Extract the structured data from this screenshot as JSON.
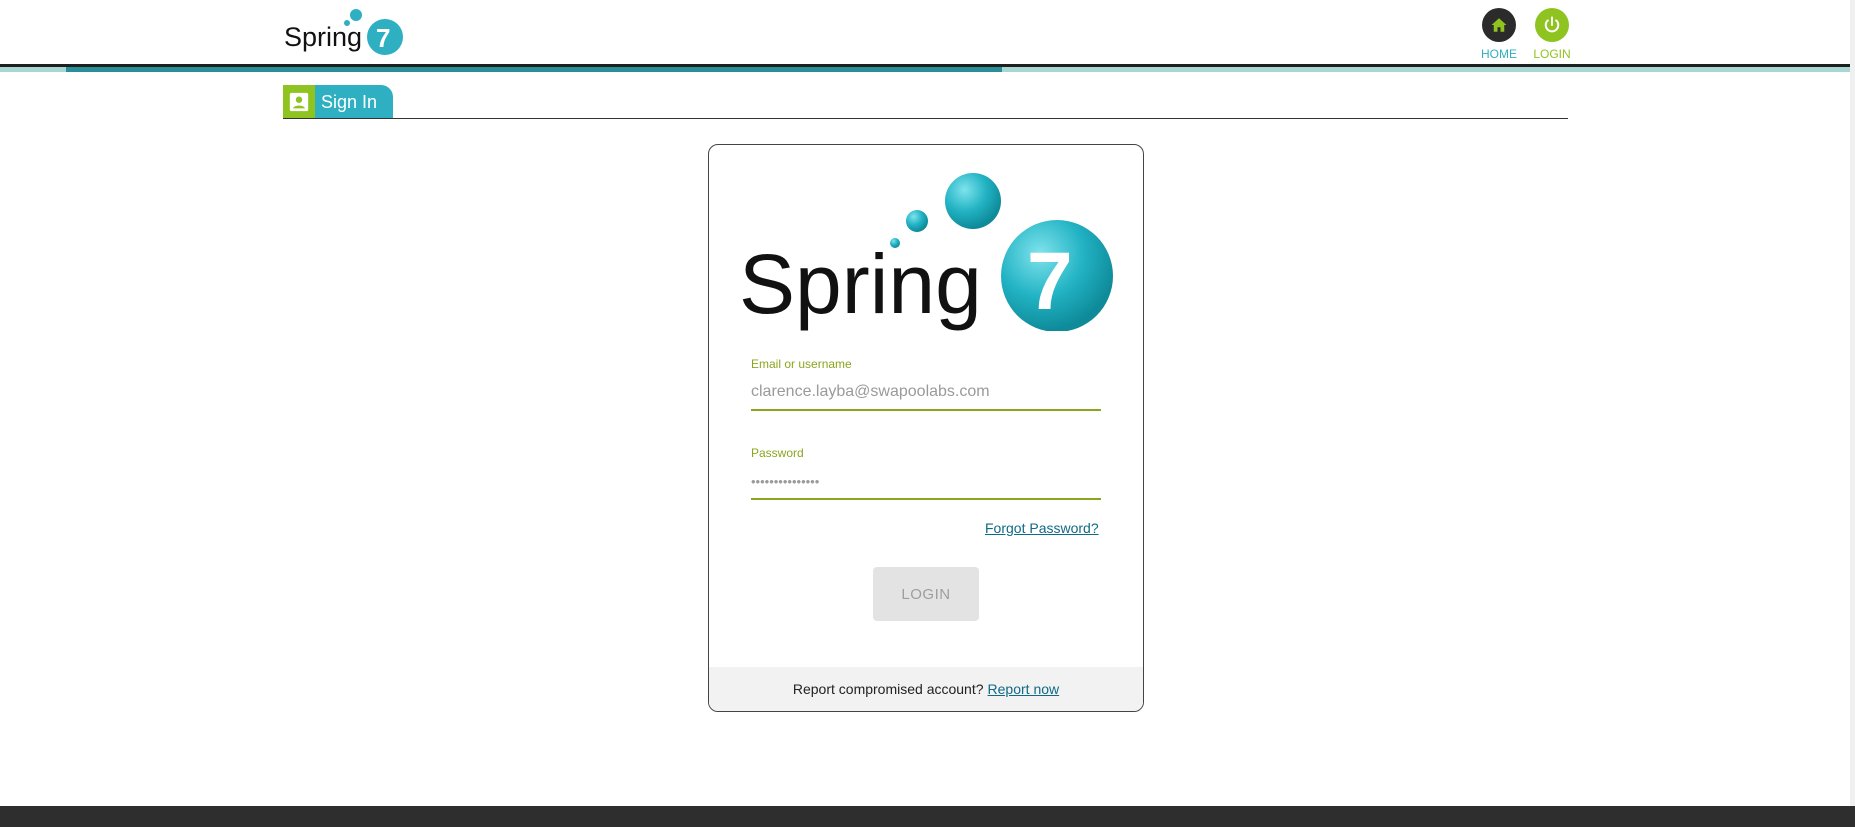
{
  "header": {
    "logo_text": "Spring7",
    "nav": {
      "home_label": "HOME",
      "login_label": "LOGIN"
    }
  },
  "tab": {
    "label": "Sign In"
  },
  "login_card": {
    "logo_text": "Spring7",
    "email": {
      "label": "Email or username",
      "value": "clarence.layba@swapoolabs.com"
    },
    "password": {
      "label": "Password",
      "value": "•••••••••••••••"
    },
    "forgot_label": "Forgot Password?",
    "login_label": "LOGIN",
    "footer": {
      "text": "Report compromised account?",
      "link": "Report now"
    }
  },
  "colors": {
    "teal": "#2fb0c2",
    "green": "#8fc31f",
    "dark": "#2b2b2b",
    "link": "#0f6a86"
  }
}
